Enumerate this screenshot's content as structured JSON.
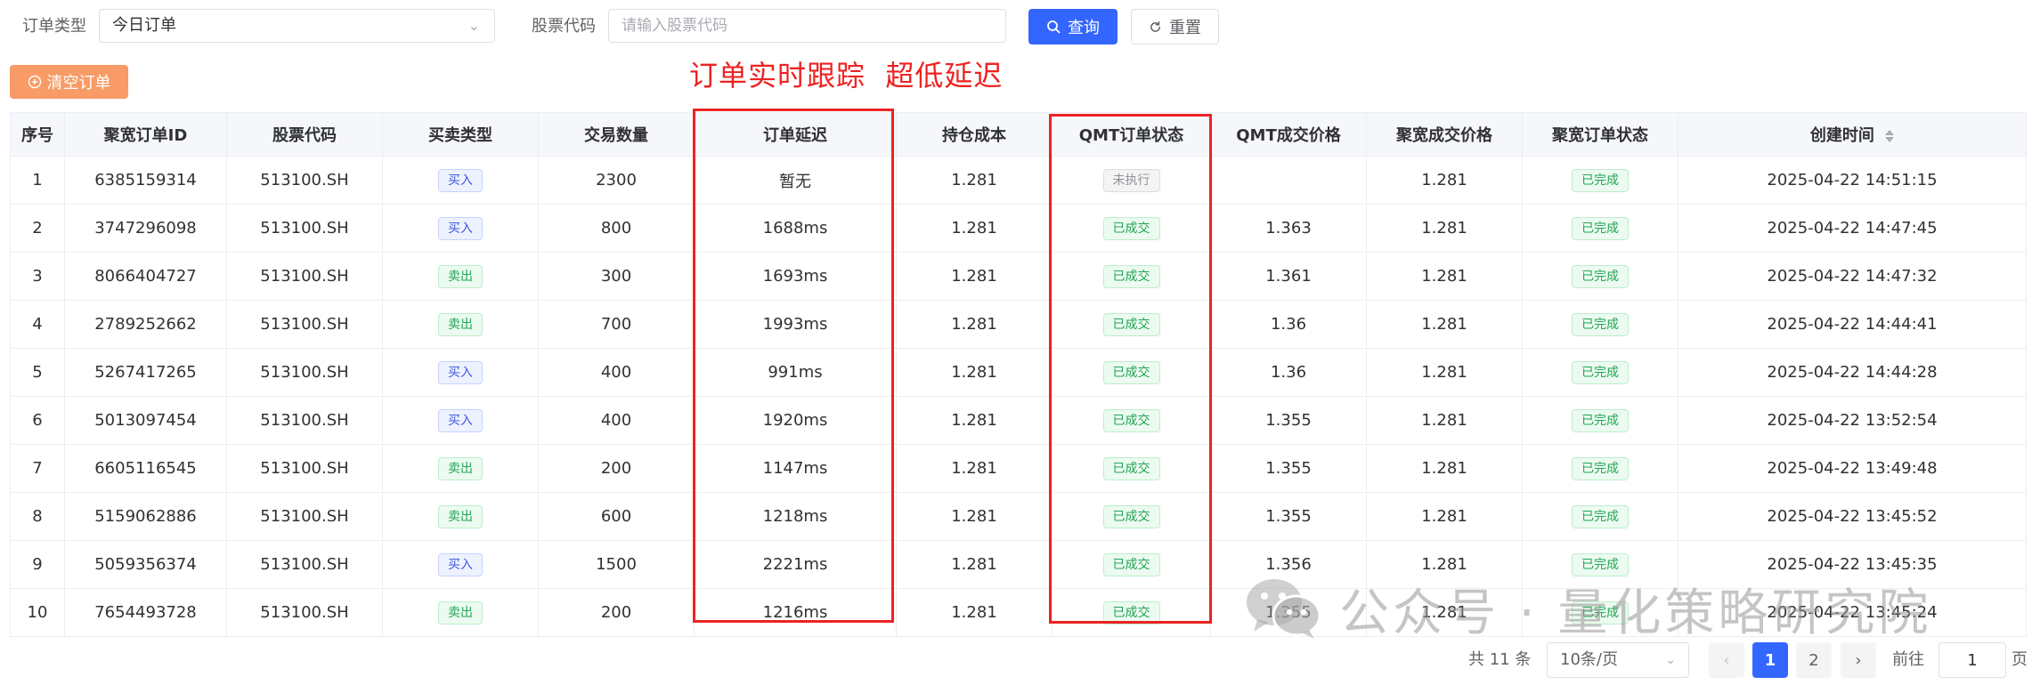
{
  "filters": {
    "order_type_label": "订单类型",
    "order_type_value": "今日订单",
    "stock_code_label": "股票代码",
    "stock_code_placeholder": "请输入股票代码",
    "query_label": "查询",
    "reset_label": "重置"
  },
  "actions": {
    "clear_label": "清空订单"
  },
  "banner": "订单实时跟踪  超低延迟",
  "table": {
    "columns": [
      "序号",
      "聚宽订单ID",
      "股票代码",
      "买卖类型",
      "交易数量",
      "订单延迟",
      "持仓成本",
      "QMT订单状态",
      "QMT成交价格",
      "聚宽成交价格",
      "聚宽订单状态",
      "创建时间"
    ],
    "rows": [
      {
        "seq": "1",
        "jq_id": "6385159314",
        "code": "513100.SH",
        "side": "买入",
        "qty": "2300",
        "delay": "暂无",
        "cost": "1.281",
        "qmt_status": "未执行",
        "qmt_price": "",
        "jq_price": "1.281",
        "jq_status": "已完成",
        "created": "2025-04-22 14:51:15"
      },
      {
        "seq": "2",
        "jq_id": "3747296098",
        "code": "513100.SH",
        "side": "买入",
        "qty": "800",
        "delay": "1688ms",
        "cost": "1.281",
        "qmt_status": "已成交",
        "qmt_price": "1.363",
        "jq_price": "1.281",
        "jq_status": "已完成",
        "created": "2025-04-22 14:47:45"
      },
      {
        "seq": "3",
        "jq_id": "8066404727",
        "code": "513100.SH",
        "side": "卖出",
        "qty": "300",
        "delay": "1693ms",
        "cost": "1.281",
        "qmt_status": "已成交",
        "qmt_price": "1.361",
        "jq_price": "1.281",
        "jq_status": "已完成",
        "created": "2025-04-22 14:47:32"
      },
      {
        "seq": "4",
        "jq_id": "2789252662",
        "code": "513100.SH",
        "side": "卖出",
        "qty": "700",
        "delay": "1993ms",
        "cost": "1.281",
        "qmt_status": "已成交",
        "qmt_price": "1.36",
        "jq_price": "1.281",
        "jq_status": "已完成",
        "created": "2025-04-22 14:44:41"
      },
      {
        "seq": "5",
        "jq_id": "5267417265",
        "code": "513100.SH",
        "side": "买入",
        "qty": "400",
        "delay": "991ms",
        "cost": "1.281",
        "qmt_status": "已成交",
        "qmt_price": "1.36",
        "jq_price": "1.281",
        "jq_status": "已完成",
        "created": "2025-04-22 14:44:28"
      },
      {
        "seq": "6",
        "jq_id": "5013097454",
        "code": "513100.SH",
        "side": "买入",
        "qty": "400",
        "delay": "1920ms",
        "cost": "1.281",
        "qmt_status": "已成交",
        "qmt_price": "1.355",
        "jq_price": "1.281",
        "jq_status": "已完成",
        "created": "2025-04-22 13:52:54"
      },
      {
        "seq": "7",
        "jq_id": "6605116545",
        "code": "513100.SH",
        "side": "卖出",
        "qty": "200",
        "delay": "1147ms",
        "cost": "1.281",
        "qmt_status": "已成交",
        "qmt_price": "1.355",
        "jq_price": "1.281",
        "jq_status": "已完成",
        "created": "2025-04-22 13:49:48"
      },
      {
        "seq": "8",
        "jq_id": "5159062886",
        "code": "513100.SH",
        "side": "卖出",
        "qty": "600",
        "delay": "1218ms",
        "cost": "1.281",
        "qmt_status": "已成交",
        "qmt_price": "1.355",
        "jq_price": "1.281",
        "jq_status": "已完成",
        "created": "2025-04-22 13:45:52"
      },
      {
        "seq": "9",
        "jq_id": "5059356374",
        "code": "513100.SH",
        "side": "买入",
        "qty": "1500",
        "delay": "2221ms",
        "cost": "1.281",
        "qmt_status": "已成交",
        "qmt_price": "1.356",
        "jq_price": "1.281",
        "jq_status": "已完成",
        "created": "2025-04-22 13:45:35"
      },
      {
        "seq": "10",
        "jq_id": "7654493728",
        "code": "513100.SH",
        "side": "卖出",
        "qty": "200",
        "delay": "1216ms",
        "cost": "1.281",
        "qmt_status": "已成交",
        "qmt_price": "1.355",
        "jq_price": "1.281",
        "jq_status": "已完成",
        "created": "2025-04-22 13:45:24"
      }
    ]
  },
  "watermark": {
    "text": "公众号 · 量化策略研究院",
    "icon": "wechat-icon"
  },
  "pagination": {
    "total": "共 11 条",
    "page_size": "10条/页",
    "pages": [
      "1",
      "2"
    ],
    "current_page": "1",
    "goto_prefix": "前往",
    "goto_value": "1",
    "goto_suffix": "页"
  },
  "colors": {
    "primary": "#3366ff",
    "clear_button": "#f89b66",
    "highlight": "#ee2222",
    "buy_tag": "#3b5bdb",
    "sell_tag": "#22a455"
  }
}
